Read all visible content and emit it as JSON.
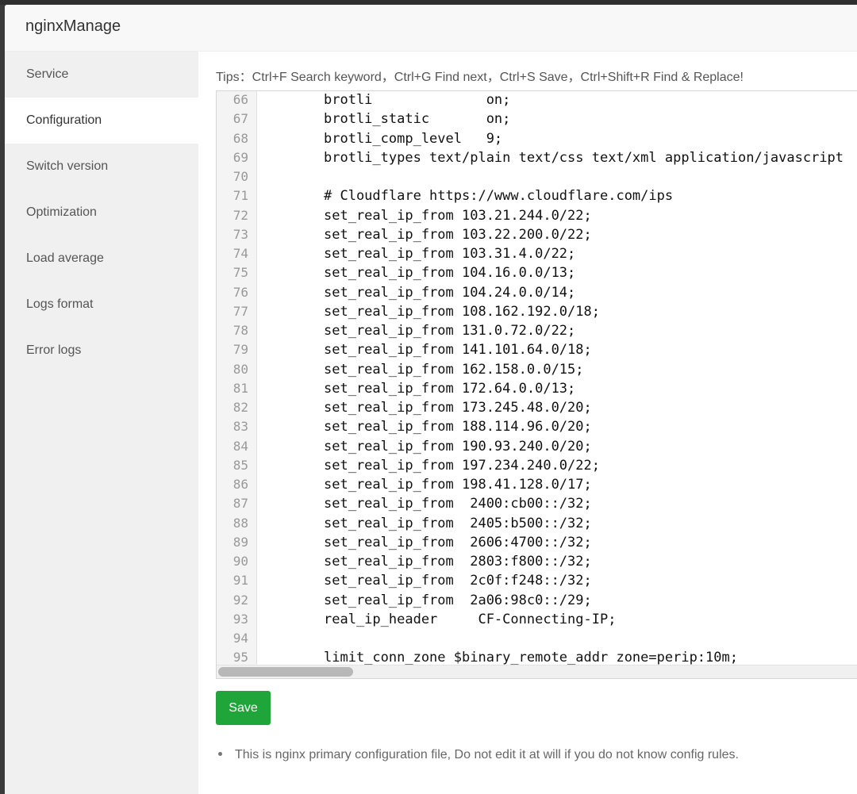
{
  "app": {
    "title": "nginxManage"
  },
  "sidebar": {
    "items": [
      {
        "label": "Service",
        "active": false
      },
      {
        "label": "Configuration",
        "active": true
      },
      {
        "label": "Switch version",
        "active": false
      },
      {
        "label": "Optimization",
        "active": false
      },
      {
        "label": "Load average",
        "active": false
      },
      {
        "label": "Logs format",
        "active": false
      },
      {
        "label": "Error logs",
        "active": false
      }
    ]
  },
  "main": {
    "tips": "Tips：Ctrl+F Search keyword，Ctrl+G Find next，Ctrl+S Save，Ctrl+Shift+R Find & Replace!",
    "save_label": "Save",
    "note": "This is nginx primary configuration file, Do not edit it at will if you do not know config rules."
  },
  "editor": {
    "lines": [
      {
        "n": "66",
        "text": "brotli              on;"
      },
      {
        "n": "67",
        "text": "brotli_static       on;"
      },
      {
        "n": "68",
        "text": "brotli_comp_level   9;"
      },
      {
        "n": "69",
        "text": "brotli_types text/plain text/css text/xml application/javascript"
      },
      {
        "n": "70",
        "text": ""
      },
      {
        "n": "71",
        "text": "# Cloudflare https://www.cloudflare.com/ips"
      },
      {
        "n": "72",
        "text": "set_real_ip_from 103.21.244.0/22;"
      },
      {
        "n": "73",
        "text": "set_real_ip_from 103.22.200.0/22;"
      },
      {
        "n": "74",
        "text": "set_real_ip_from 103.31.4.0/22;"
      },
      {
        "n": "75",
        "text": "set_real_ip_from 104.16.0.0/13;"
      },
      {
        "n": "76",
        "text": "set_real_ip_from 104.24.0.0/14;"
      },
      {
        "n": "77",
        "text": "set_real_ip_from 108.162.192.0/18;"
      },
      {
        "n": "78",
        "text": "set_real_ip_from 131.0.72.0/22;"
      },
      {
        "n": "79",
        "text": "set_real_ip_from 141.101.64.0/18;"
      },
      {
        "n": "80",
        "text": "set_real_ip_from 162.158.0.0/15;"
      },
      {
        "n": "81",
        "text": "set_real_ip_from 172.64.0.0/13;"
      },
      {
        "n": "82",
        "text": "set_real_ip_from 173.245.48.0/20;"
      },
      {
        "n": "83",
        "text": "set_real_ip_from 188.114.96.0/20;"
      },
      {
        "n": "84",
        "text": "set_real_ip_from 190.93.240.0/20;"
      },
      {
        "n": "85",
        "text": "set_real_ip_from 197.234.240.0/22;"
      },
      {
        "n": "86",
        "text": "set_real_ip_from 198.41.128.0/17;"
      },
      {
        "n": "87",
        "text": "set_real_ip_from  2400:cb00::/32;"
      },
      {
        "n": "88",
        "text": "set_real_ip_from  2405:b500::/32;"
      },
      {
        "n": "89",
        "text": "set_real_ip_from  2606:4700::/32;"
      },
      {
        "n": "90",
        "text": "set_real_ip_from  2803:f800::/32;"
      },
      {
        "n": "91",
        "text": "set_real_ip_from  2c0f:f248::/32;"
      },
      {
        "n": "92",
        "text": "set_real_ip_from  2a06:98c0::/29;"
      },
      {
        "n": "93",
        "text": "real_ip_header     CF-Connecting-IP;"
      },
      {
        "n": "94",
        "text": ""
      },
      {
        "n": "95",
        "text": "limit_conn_zone $binary_remote_addr zone=perip:10m;"
      }
    ]
  }
}
